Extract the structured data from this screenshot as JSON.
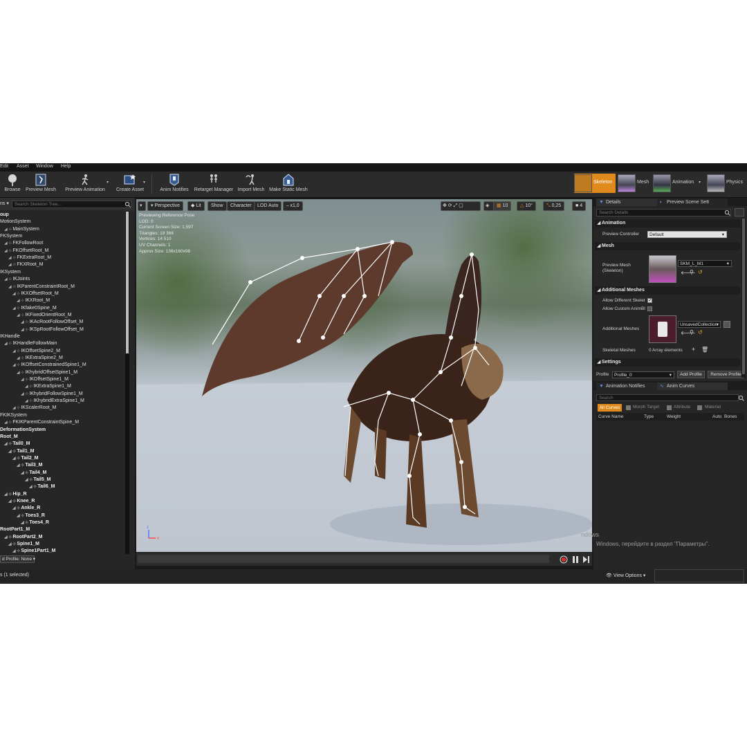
{
  "menu": [
    "Edit",
    "Asset",
    "Window",
    "Help"
  ],
  "toolbar": {
    "browse": "Browse",
    "preview_mesh": "Preview Mesh",
    "preview_animation": "Preview Animation",
    "create_asset": "Create Asset",
    "anim_notifies": "Anim Notifies",
    "retarget_manager": "Retarget Manager",
    "import_mesh": "Import Mesh",
    "make_static_mesh": "Make Static Mesh"
  },
  "modes": {
    "skeleton": "Skeleton",
    "mesh": "Mesh",
    "animation": "Animation",
    "physics": "Physics"
  },
  "skeleton_tree": {
    "options_label": "ns",
    "search_placeholder": "Search Skeleton Tree...",
    "rows": [
      "oup",
      "MotionSystem",
      "MainSystem",
      "FKSystem",
      "FKFollowRoot",
      "FKOffsetRoot_M",
      "FKExtraRoot_M",
      "FKXRoot_M",
      "IKSystem",
      "IKJoints",
      "IKParentConstraintRoot_M",
      "IKXOffsetRoot_M",
      "IKXRoot_M",
      "IKfake0Spine_M",
      "IKFixedOrientRoot_M",
      "IKAcRootFollowOffset_M",
      "IKSpRootFollowOffset_M",
      "IKHandle",
      "IKHandleFollowMain",
      "IKOffsetSpine2_M",
      "IKExtraSpine2_M",
      "IKOffsetConstrainedSpine1_M",
      "IKhybridOffsetSpine1_M",
      "IKOffsetSpine1_M",
      "IKExtraSpine1_M",
      "IKhybridFollowSpine1_M",
      "IKhybridExtraSpine1_M",
      "IKScalerRoot_M",
      "FKIKSystem",
      "FKIKParentConstraintSpine_M",
      "DeformationSystem",
      "Root_M",
      "Tail0_M",
      "Tail1_M",
      "Tail2_M",
      "Tail3_M",
      "Tail4_M",
      "Tail5_M",
      "Tail6_M",
      "Hip_R",
      "Knee_R",
      "Ankle_R",
      "Toes3_R",
      "Toes4_R",
      "RootPart1_M",
      "RootPart2_M",
      "Spine1_M",
      "Spine1Part1_M"
    ],
    "profile_label": "d Profile: None",
    "selection_status": "s (1 selected)"
  },
  "viewport": {
    "perspective": "Perspective",
    "lit": "Lit",
    "show": "Show",
    "character": "Character",
    "lod": "LOD Auto",
    "speed": "x1,0",
    "grid_snap": "10",
    "rot_snap": "10°",
    "scale_snap": "0,25",
    "cam_speed": "4",
    "stats": [
      "Previewing Reference Pose",
      "LOD: 0",
      "Current Screen Size: 1,597",
      "Triangles: 18 366",
      "Vertices: 14 510",
      "UV Channels: 1",
      "Approx Size: 138x160x98"
    ]
  },
  "details": {
    "tab_details": "Details",
    "tab_preview": "Preview Scene Sett",
    "search_placeholder": "Search Details",
    "sec_animation": "Animation",
    "preview_controller_label": "Preview Controller",
    "preview_controller_value": "Default",
    "sec_mesh": "Mesh",
    "preview_mesh_label": "Preview Mesh (Skeleton)",
    "preview_mesh_value": "SKM_L_M1",
    "sec_additional": "Additional Meshes",
    "allow_diff_skeletons": "Allow Different Skelet",
    "allow_custom_anim": "Allow Custom AnimBl",
    "additional_meshes_label": "Additional Meshes",
    "additional_meshes_value": "UnsavedCollection",
    "skeletal_meshes_label": "Skeletal Meshes",
    "skeletal_meshes_value": "0 Array elements",
    "sec_settings": "Settings",
    "profile_label": "Profile",
    "profile_value": "Profile_0",
    "add_profile": "Add Profile",
    "remove_profile": "Remove Profile"
  },
  "curves": {
    "tab_notifies": "Animation Notifies",
    "tab_curves": "Anim Curves",
    "search_placeholder": "Search",
    "filter_all": "All Curves",
    "filter_morph": "Morph Target",
    "filter_attribute": "Attribute",
    "filter_material": "Material",
    "col_name": "Curve Name",
    "col_type": "Type",
    "col_weight": "Weight",
    "col_auto": "Auto",
    "col_bones": "Bones"
  },
  "status": {
    "view_options": "View Options",
    "watermark1": "ndows",
    "watermark2": "Windows, перейдите в раздел \"Параметры\"."
  }
}
